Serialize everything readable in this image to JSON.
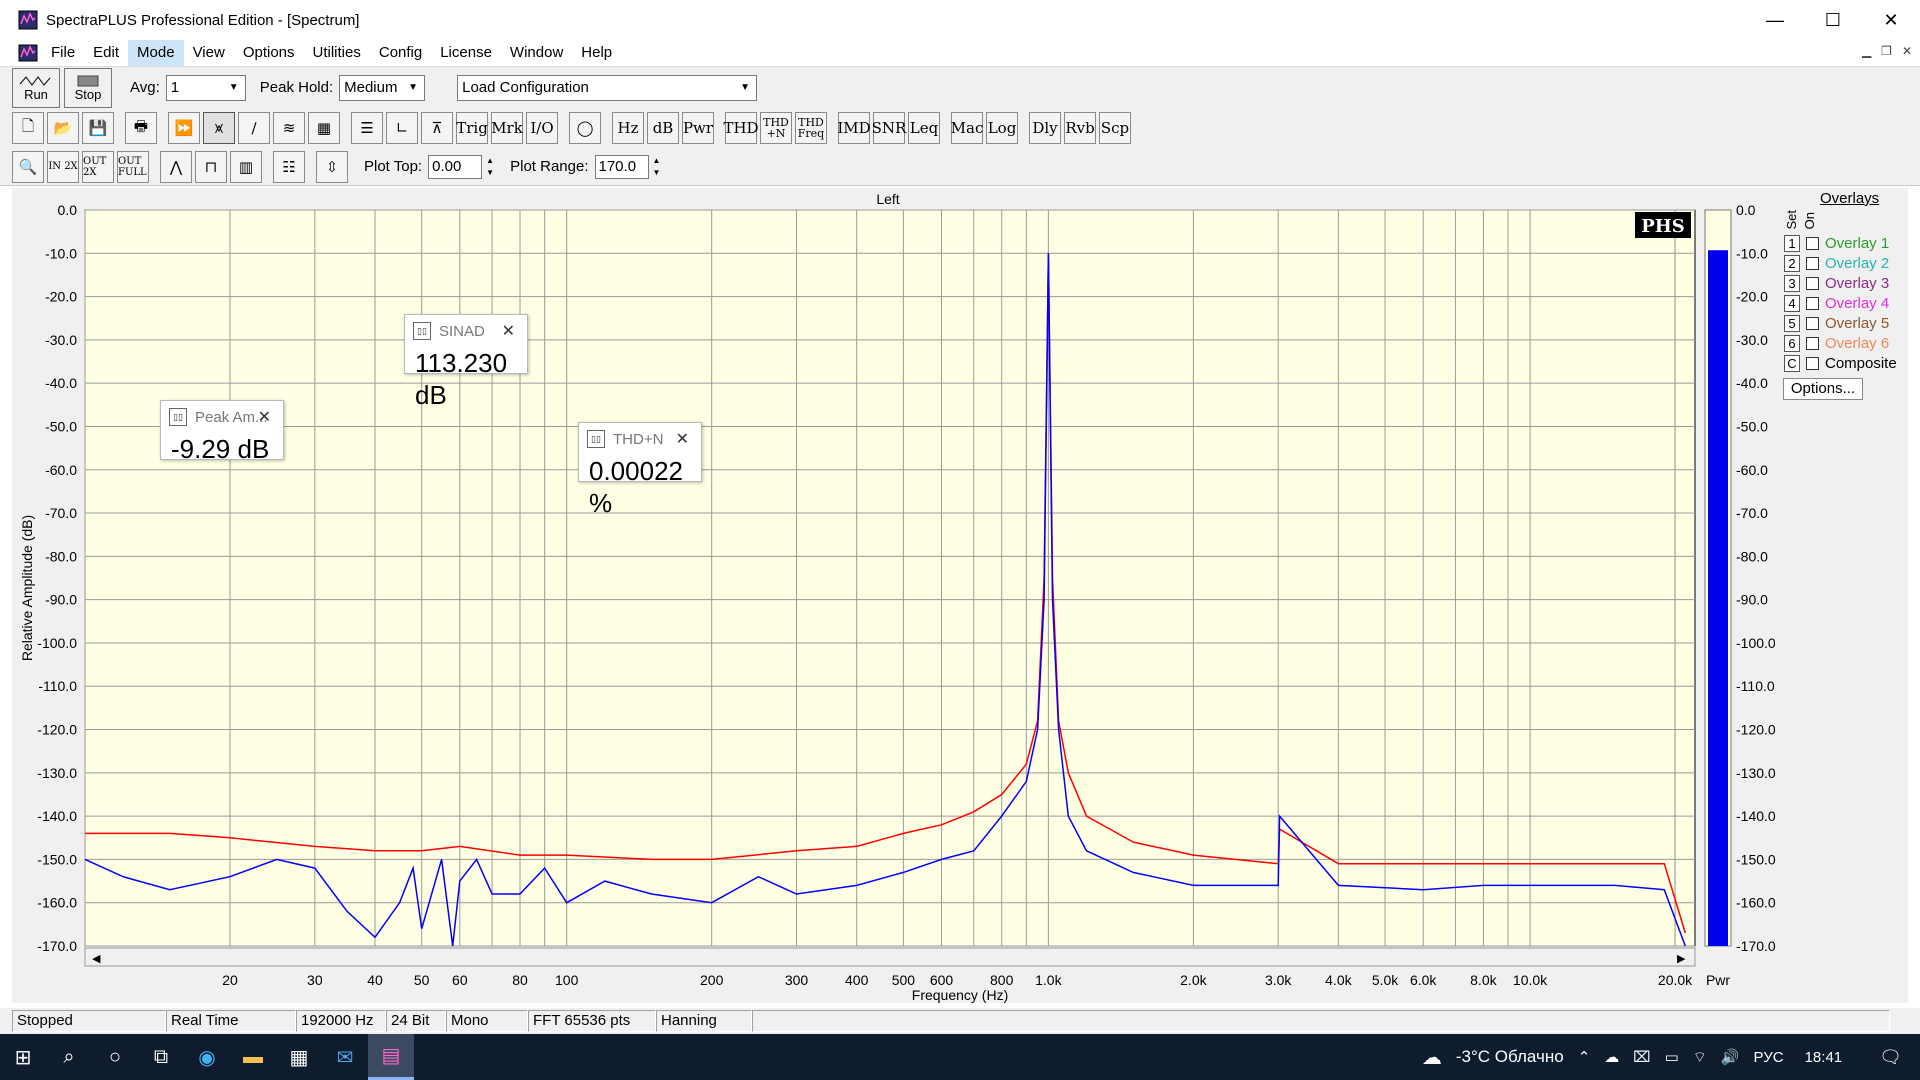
{
  "window": {
    "title": "SpectraPLUS Professional Edition - [Spectrum]",
    "minimize_glyph": "—",
    "maximize_glyph": "☐",
    "close_glyph": "✕"
  },
  "menu": [
    "File",
    "Edit",
    "Mode",
    "View",
    "Options",
    "Utilities",
    "Config",
    "License",
    "Window",
    "Help"
  ],
  "menu_active": "Mode",
  "toolbar": {
    "run_label": "Run",
    "stop_label": "Stop",
    "avg_label": "Avg:",
    "avg_value": "1",
    "peak_hold_label": "Peak Hold:",
    "peak_hold_value": "Medium",
    "load_config_value": "Load Configuration",
    "plot_top_label": "Plot Top:",
    "plot_top_value": "0.00",
    "plot_range_label": "Plot Range:",
    "plot_range_value": "170.0"
  },
  "tool_buttons": [
    "Trig",
    "Mrk",
    "I/O",
    "Hz",
    "dB",
    "Pwr",
    "THD",
    "THD +N",
    "THD Freq",
    "IMD",
    "SNR",
    "Leq",
    "Mac",
    "Log",
    "Dly",
    "Rvb",
    "Scp"
  ],
  "meters": {
    "peak": {
      "title": "Peak Am...",
      "value": "-9.29 dB"
    },
    "sinad": {
      "title": "SINAD",
      "value": "113.230 dB"
    },
    "thdn": {
      "title": "THD+N",
      "value": "0.00022 %"
    }
  },
  "overlays": {
    "header": "Overlays",
    "set_label": "Set",
    "on_label": "On",
    "items": [
      {
        "num": "1",
        "label": "Overlay 1",
        "color": "#2e9b2e"
      },
      {
        "num": "2",
        "label": "Overlay 2",
        "color": "#27b5b5"
      },
      {
        "num": "3",
        "label": "Overlay 3",
        "color": "#8a2b8a"
      },
      {
        "num": "4",
        "label": "Overlay 4",
        "color": "#e22ee2"
      },
      {
        "num": "5",
        "label": "Overlay 5",
        "color": "#8a5a2b"
      },
      {
        "num": "6",
        "label": "Overlay 6",
        "color": "#f0885a"
      },
      {
        "num": "C",
        "label": "Composite",
        "color": "#000000"
      }
    ],
    "options_label": "Options..."
  },
  "status": {
    "state": "Stopped",
    "mode": "Real Time",
    "rate": "192000 Hz",
    "bits": "24 Bit",
    "channels": "Mono",
    "fft": "FFT 65536 pts",
    "window": "Hanning"
  },
  "taskbar": {
    "weather": "-3°C Облачно",
    "lang": "РУС",
    "time": "18:41"
  },
  "chart_data": {
    "type": "line",
    "title": "Left",
    "xlabel": "Frequency (Hz)",
    "ylabel": "Relative Amplitude (dB)",
    "xscale": "log",
    "xlim": [
      10,
      22000
    ],
    "ylim": [
      -170,
      0
    ],
    "grid": true,
    "brand": "PHS",
    "x_tick_labels": [
      {
        "v": 20,
        "t": "20"
      },
      {
        "v": 30,
        "t": "30"
      },
      {
        "v": 40,
        "t": "40"
      },
      {
        "v": 50,
        "t": "50"
      },
      {
        "v": 60,
        "t": "60"
      },
      {
        "v": 80,
        "t": "80"
      },
      {
        "v": 100,
        "t": "100"
      },
      {
        "v": 200,
        "t": "200"
      },
      {
        "v": 300,
        "t": "300"
      },
      {
        "v": 400,
        "t": "400"
      },
      {
        "v": 500,
        "t": "500"
      },
      {
        "v": 600,
        "t": "600"
      },
      {
        "v": 800,
        "t": "800"
      },
      {
        "v": 1000,
        "t": "1.0k"
      },
      {
        "v": 2000,
        "t": "2.0k"
      },
      {
        "v": 3000,
        "t": "3.0k"
      },
      {
        "v": 4000,
        "t": "4.0k"
      },
      {
        "v": 5000,
        "t": "5.0k"
      },
      {
        "v": 6000,
        "t": "6.0k"
      },
      {
        "v": 8000,
        "t": "8.0k"
      },
      {
        "v": 10000,
        "t": "10.0k"
      },
      {
        "v": 20000,
        "t": "20.0k"
      }
    ],
    "y_ticks": [
      0,
      -10,
      -20,
      -30,
      -40,
      -50,
      -60,
      -70,
      -80,
      -90,
      -100,
      -110,
      -120,
      -130,
      -140,
      -150,
      -160,
      -170
    ],
    "y_tick_labels": [
      "0.0",
      "-10.0",
      "-20.0",
      "-30.0",
      "-40.0",
      "-50.0",
      "-60.0",
      "-70.0",
      "-80.0",
      "-90.0",
      "-100.0",
      "-110.0",
      "-120.0",
      "-130.0",
      "-140.0",
      "-150.0",
      "-160.0",
      "-170.0"
    ],
    "series": [
      {
        "color": "#ff0000",
        "x": [
          10,
          15,
          20,
          30,
          40,
          50,
          60,
          80,
          100,
          150,
          200,
          300,
          400,
          500,
          600,
          700,
          800,
          900,
          950,
          980,
          1000,
          1020,
          1050,
          1100,
          1200,
          1500,
          2000,
          3000,
          3020,
          4000,
          6000,
          8000,
          10000,
          15000,
          19000,
          21000
        ],
        "y": [
          -144,
          -144,
          -145,
          -147,
          -148,
          -148,
          -147,
          -149,
          -149,
          -150,
          -150,
          -148,
          -147,
          -144,
          -142,
          -139,
          -135,
          -128,
          -118,
          -85,
          -10,
          -85,
          -118,
          -130,
          -140,
          -146,
          -149,
          -151,
          -143,
          -151,
          -151,
          -151,
          -151,
          -151,
          -151,
          -167
        ]
      },
      {
        "color": "#0000ff",
        "x": [
          10,
          12,
          15,
          20,
          25,
          30,
          35,
          40,
          45,
          48,
          50,
          55,
          58,
          60,
          65,
          70,
          80,
          90,
          100,
          120,
          150,
          200,
          250,
          300,
          400,
          500,
          600,
          700,
          800,
          900,
          950,
          980,
          1000,
          1020,
          1050,
          1100,
          1200,
          1500,
          2000,
          3000,
          3020,
          4000,
          6000,
          8000,
          10000,
          15000,
          19000,
          21000
        ],
        "y": [
          -150,
          -154,
          -157,
          -154,
          -150,
          -152,
          -162,
          -168,
          -160,
          -152,
          -166,
          -150,
          -170,
          -155,
          -150,
          -158,
          -158,
          -152,
          -160,
          -155,
          -158,
          -160,
          -154,
          -158,
          -156,
          -153,
          -150,
          -148,
          -140,
          -132,
          -120,
          -90,
          -10,
          -90,
          -120,
          -140,
          -148,
          -153,
          -156,
          -156,
          -140,
          -156,
          -157,
          -156,
          -156,
          -156,
          -157,
          -170
        ]
      }
    ],
    "pwr_bar": {
      "label": "Pwr",
      "value": -9.29,
      "color": "#0000ee"
    }
  }
}
